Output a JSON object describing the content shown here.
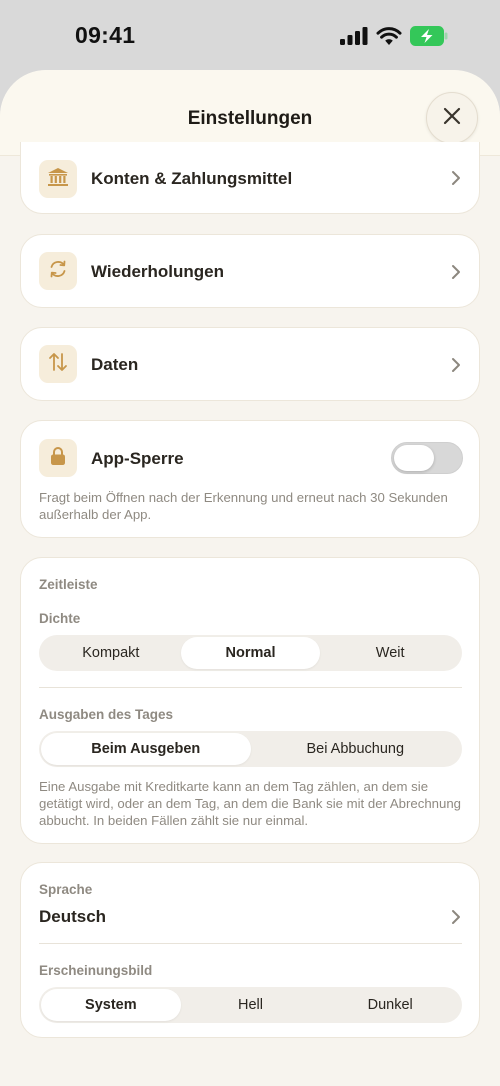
{
  "status_bar": {
    "time": "09:41"
  },
  "header": {
    "title": "Einstellungen"
  },
  "nav_items": [
    {
      "label": "Konten & Zahlungsmittel",
      "icon": "bank-icon"
    },
    {
      "label": "Wiederholungen",
      "icon": "repeat-icon"
    },
    {
      "label": "Daten",
      "icon": "transfer-arrows-icon"
    }
  ],
  "app_lock": {
    "label": "App-Sperre",
    "icon": "lock-icon",
    "enabled": false,
    "description": "Fragt beim Öffnen nach der Erkennung und erneut nach 30 Sekunden außerhalb der App."
  },
  "timeline": {
    "title": "Zeitleiste",
    "density": {
      "label": "Dichte",
      "options": [
        "Kompakt",
        "Normal",
        "Weit"
      ],
      "selected": "Normal"
    },
    "daily_spend": {
      "label": "Ausgaben des Tages",
      "options": [
        "Beim Ausgeben",
        "Bei Abbuchung"
      ],
      "selected": "Beim Ausgeben"
    },
    "description": "Eine Ausgabe mit Kreditkarte kann an dem Tag zählen, an dem sie getätigt wird, oder an dem Tag, an dem die Bank sie mit der Abrechnung abbucht. In beiden Fällen zählt sie nur einmal."
  },
  "general": {
    "language": {
      "label": "Sprache",
      "value": "Deutsch"
    },
    "appearance": {
      "label": "Erscheinungsbild",
      "options": [
        "System",
        "Hell",
        "Dunkel"
      ],
      "selected": "System"
    }
  },
  "colors": {
    "accent": "#c7964a",
    "icon_tile": "#f6eddb",
    "battery": "#34c759"
  }
}
